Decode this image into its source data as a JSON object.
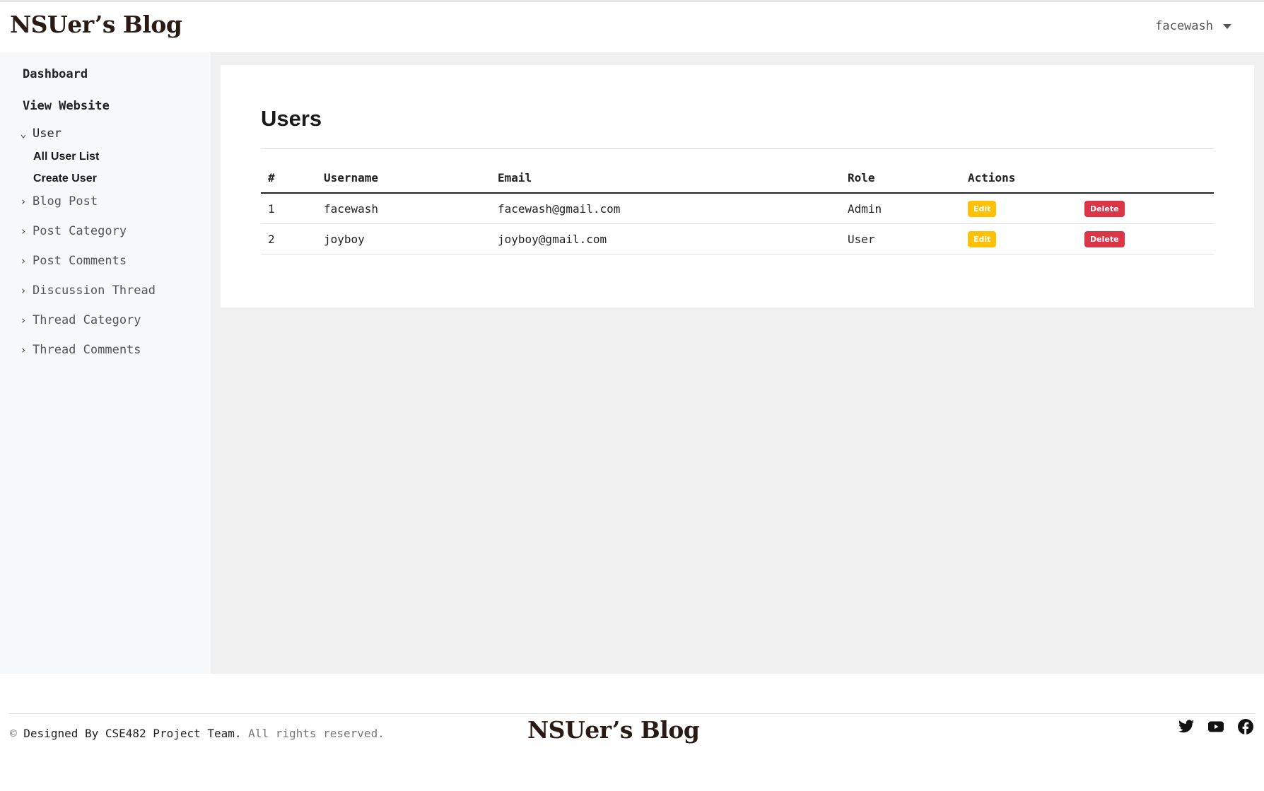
{
  "header": {
    "brand": "NSUer’s Blog",
    "user_menu_label": "facewash"
  },
  "sidebar": {
    "dashboard": "Dashboard",
    "view_website": "View Website",
    "user_group": {
      "label": "User",
      "items": [
        "All User List",
        "Create User"
      ]
    },
    "groups": [
      "Blog Post",
      "Post Category",
      "Post Comments",
      "Discussion Thread",
      "Thread Category",
      "Thread Comments"
    ]
  },
  "main": {
    "title": "Users",
    "table": {
      "columns": [
        "#",
        "Username",
        "Email",
        "Role",
        "Actions"
      ],
      "rows": [
        {
          "id": "1",
          "username": "facewash",
          "email": "facewash@gmail.com",
          "role": "Admin",
          "edit": "Edit",
          "delete": "Delete"
        },
        {
          "id": "2",
          "username": "joyboy",
          "email": "joyboy@gmail.com",
          "role": "User",
          "edit": "Edit",
          "delete": "Delete"
        }
      ]
    }
  },
  "footer": {
    "copyright_symbol": "©",
    "designed_by": "Designed By CSE482 Project Team.",
    "rights": "All rights reserved.",
    "brand": "NSUer’s Blog",
    "social_icons": [
      "twitter-icon",
      "youtube-icon",
      "facebook-icon"
    ]
  },
  "colors": {
    "edit": "#ffc107",
    "delete": "#dc3545",
    "sidebar_bg": "#f7f8fa",
    "content_bg": "#f0f0f0"
  }
}
